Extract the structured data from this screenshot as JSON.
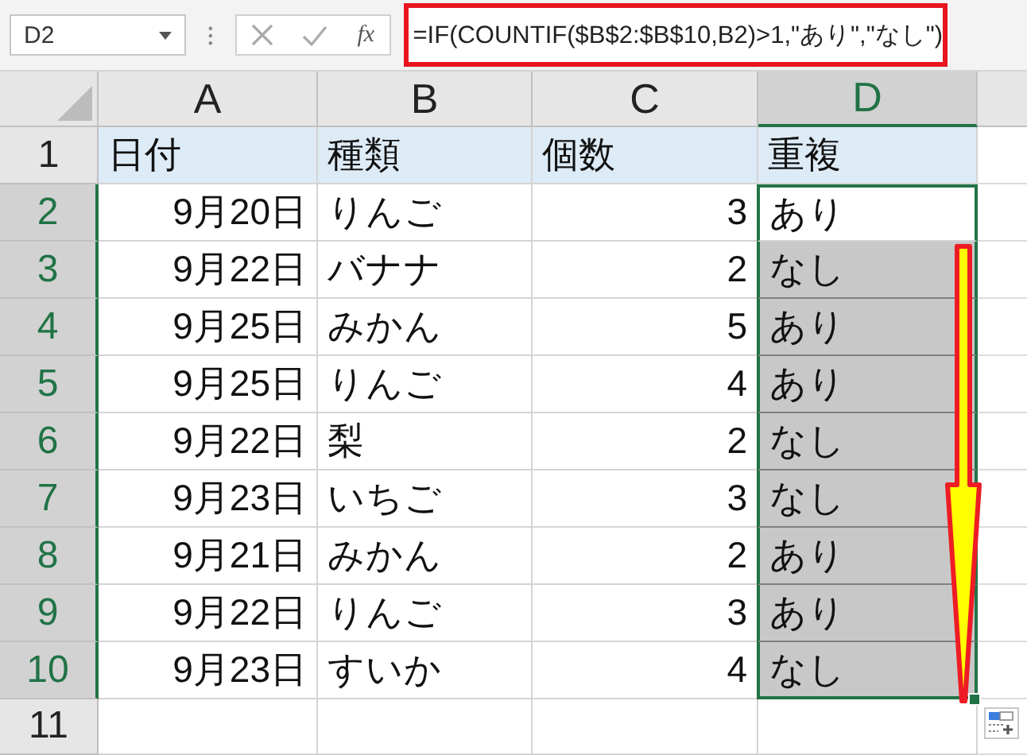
{
  "name_box": {
    "value": "D2"
  },
  "formula_bar": {
    "fx": "fx",
    "value": "=IF(COUNTIF($B$2:$B$10,B2)>1,\"あり\",\"なし\")",
    "highlighted": true
  },
  "columns": [
    {
      "label": "A",
      "selected": false
    },
    {
      "label": "B",
      "selected": false
    },
    {
      "label": "C",
      "selected": false
    },
    {
      "label": "D",
      "selected": true
    }
  ],
  "rows": [
    {
      "number": "1",
      "selected": false,
      "cells": [
        {
          "text": "日付",
          "kind": "header",
          "highlighted": false
        },
        {
          "text": "種類",
          "kind": "header",
          "highlighted": false
        },
        {
          "text": "個数",
          "kind": "header",
          "highlighted": false
        },
        {
          "text": "重複",
          "kind": "header",
          "highlighted": false
        }
      ]
    },
    {
      "number": "2",
      "selected": true,
      "cells": [
        {
          "text": "9月20日",
          "kind": "number",
          "highlighted": false
        },
        {
          "text": "りんご",
          "kind": "text",
          "highlighted": false
        },
        {
          "text": "3",
          "kind": "number",
          "highlighted": false
        },
        {
          "text": "あり",
          "kind": "text",
          "highlighted": false
        }
      ]
    },
    {
      "number": "3",
      "selected": true,
      "cells": [
        {
          "text": "9月22日",
          "kind": "number",
          "highlighted": false
        },
        {
          "text": "バナナ",
          "kind": "text",
          "highlighted": false
        },
        {
          "text": "2",
          "kind": "number",
          "highlighted": false
        },
        {
          "text": "なし",
          "kind": "text",
          "highlighted": true
        }
      ]
    },
    {
      "number": "4",
      "selected": true,
      "cells": [
        {
          "text": "9月25日",
          "kind": "number",
          "highlighted": false
        },
        {
          "text": "みかん",
          "kind": "text",
          "highlighted": false
        },
        {
          "text": "5",
          "kind": "number",
          "highlighted": false
        },
        {
          "text": "あり",
          "kind": "text",
          "highlighted": true
        }
      ]
    },
    {
      "number": "5",
      "selected": true,
      "cells": [
        {
          "text": "9月25日",
          "kind": "number",
          "highlighted": false
        },
        {
          "text": "りんご",
          "kind": "text",
          "highlighted": false
        },
        {
          "text": "4",
          "kind": "number",
          "highlighted": false
        },
        {
          "text": "あり",
          "kind": "text",
          "highlighted": true
        }
      ]
    },
    {
      "number": "6",
      "selected": true,
      "cells": [
        {
          "text": "9月22日",
          "kind": "number",
          "highlighted": false
        },
        {
          "text": "梨",
          "kind": "text",
          "highlighted": false
        },
        {
          "text": "2",
          "kind": "number",
          "highlighted": false
        },
        {
          "text": "なし",
          "kind": "text",
          "highlighted": true
        }
      ]
    },
    {
      "number": "7",
      "selected": true,
      "cells": [
        {
          "text": "9月23日",
          "kind": "number",
          "highlighted": false
        },
        {
          "text": "いちご",
          "kind": "text",
          "highlighted": false
        },
        {
          "text": "3",
          "kind": "number",
          "highlighted": false
        },
        {
          "text": "なし",
          "kind": "text",
          "highlighted": true
        }
      ]
    },
    {
      "number": "8",
      "selected": true,
      "cells": [
        {
          "text": "9月21日",
          "kind": "number",
          "highlighted": false
        },
        {
          "text": "みかん",
          "kind": "text",
          "highlighted": false
        },
        {
          "text": "2",
          "kind": "number",
          "highlighted": false
        },
        {
          "text": "あり",
          "kind": "text",
          "highlighted": true
        }
      ]
    },
    {
      "number": "9",
      "selected": true,
      "cells": [
        {
          "text": "9月22日",
          "kind": "number",
          "highlighted": false
        },
        {
          "text": "りんご",
          "kind": "text",
          "highlighted": false
        },
        {
          "text": "3",
          "kind": "number",
          "highlighted": false
        },
        {
          "text": "あり",
          "kind": "text",
          "highlighted": true
        }
      ]
    },
    {
      "number": "10",
      "selected": true,
      "cells": [
        {
          "text": "9月23日",
          "kind": "number",
          "highlighted": false
        },
        {
          "text": "すいか",
          "kind": "text",
          "highlighted": false
        },
        {
          "text": "4",
          "kind": "number",
          "highlighted": false
        },
        {
          "text": "なし",
          "kind": "text",
          "highlighted": true
        }
      ]
    },
    {
      "number": "11",
      "selected": false,
      "cells": []
    }
  ]
}
